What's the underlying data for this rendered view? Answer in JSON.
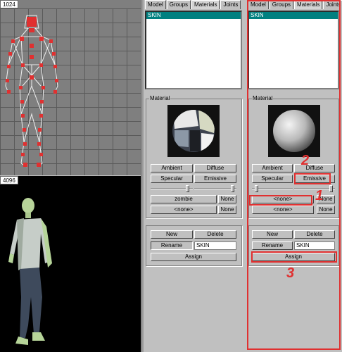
{
  "viewport_top": {
    "label": "1024"
  },
  "viewport_bottom": {
    "label": "4096"
  },
  "tabs": [
    "Model",
    "Groups",
    "Materials",
    "Joints"
  ],
  "panels": [
    {
      "list_items": [
        "SKIN"
      ],
      "material_title": "Material",
      "buttons": {
        "ambient": "Ambient",
        "diffuse": "Diffuse",
        "specular": "Specular",
        "emissive": "Emissive",
        "texture": "zombie",
        "texture_none": "None",
        "alpha": "<none>",
        "alpha_none": "None",
        "new": "New",
        "delete": "Delete",
        "rename": "Rename",
        "assign": "Assign"
      },
      "name_value": "SKIN"
    },
    {
      "list_items": [
        "SKIN"
      ],
      "material_title": "Material",
      "buttons": {
        "ambient": "Ambient",
        "diffuse": "Diffuse",
        "specular": "Specular",
        "emissive": "Emissive",
        "texture": "<none>",
        "texture_none": "None",
        "alpha": "<none>",
        "alpha_none": "None",
        "new": "New",
        "delete": "Delete",
        "rename": "Rename",
        "assign": "Assign"
      },
      "name_value": "SKIN"
    }
  ],
  "annotations": [
    "1",
    "2",
    "3"
  ],
  "colors": {
    "highlight": "#e03030",
    "selection": "#008080",
    "panel_bg": "#c0c0c0"
  }
}
